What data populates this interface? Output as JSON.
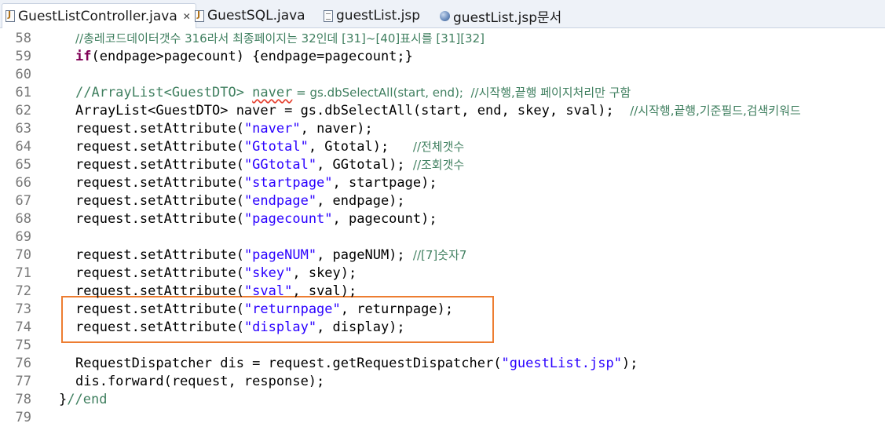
{
  "tabs": [
    {
      "label": "GuestListController.java",
      "icon": "java-file-icon",
      "close": "✕",
      "active": true
    },
    {
      "label": "GuestSQL.java",
      "icon": "java-file-icon",
      "active": false
    },
    {
      "label": "guestList.jsp",
      "icon": "jsp-file-icon",
      "active": false
    },
    {
      "label": "guestList.jsp문서",
      "icon": "globe-icon",
      "active": false
    }
  ],
  "editor": {
    "highlight_color": "#ed7d31",
    "highlighted_lines": [
      73,
      74
    ],
    "lines": [
      {
        "num": "58",
        "parts": [
          {
            "cls": "cm",
            "t": "//총레코드데이터갯수 316라서 최종페이지는 32인데 [31]~[40]표시를 [31][32]"
          }
        ]
      },
      {
        "num": "59",
        "parts": [
          {
            "cls": "kw",
            "t": "if"
          },
          {
            "cls": "",
            "t": "(endpage>pagecount) {endpage=pagecount;}"
          }
        ]
      },
      {
        "num": "60",
        "parts": []
      },
      {
        "num": "61",
        "parts": [
          {
            "cls": "cm",
            "t": "//ArrayList<GuestDTO> "
          },
          {
            "cls": "cm squiggle",
            "t": "naver"
          },
          {
            "cls": "cm",
            "t": " = gs.dbSelectAll(start, end);  //시작행,끝행 페이지처리만 구함"
          }
        ]
      },
      {
        "num": "62",
        "parts": [
          {
            "cls": "",
            "t": "ArrayList<GuestDTO> naver = gs.dbSelectAll(start, end, skey, sval);  "
          },
          {
            "cls": "cm",
            "t": "//시작행,끝행,기준필드,검색키워드"
          }
        ]
      },
      {
        "num": "63",
        "parts": [
          {
            "cls": "",
            "t": "request.setAttribute("
          },
          {
            "cls": "str",
            "t": "\"naver\""
          },
          {
            "cls": "",
            "t": ", naver);"
          }
        ]
      },
      {
        "num": "64",
        "parts": [
          {
            "cls": "",
            "t": "request.setAttribute("
          },
          {
            "cls": "str",
            "t": "\"Gtotal\""
          },
          {
            "cls": "",
            "t": ", Gtotal);   "
          },
          {
            "cls": "cm",
            "t": "//전체갯수"
          }
        ]
      },
      {
        "num": "65",
        "parts": [
          {
            "cls": "",
            "t": "request.setAttribute("
          },
          {
            "cls": "str",
            "t": "\"GGtotal\""
          },
          {
            "cls": "",
            "t": ", GGtotal); "
          },
          {
            "cls": "cm",
            "t": "//조회갯수"
          }
        ]
      },
      {
        "num": "66",
        "parts": [
          {
            "cls": "",
            "t": "request.setAttribute("
          },
          {
            "cls": "str",
            "t": "\"startpage\""
          },
          {
            "cls": "",
            "t": ", startpage);"
          }
        ]
      },
      {
        "num": "67",
        "parts": [
          {
            "cls": "",
            "t": "request.setAttribute("
          },
          {
            "cls": "str",
            "t": "\"endpage\""
          },
          {
            "cls": "",
            "t": ", endpage);"
          }
        ]
      },
      {
        "num": "68",
        "parts": [
          {
            "cls": "",
            "t": "request.setAttribute("
          },
          {
            "cls": "str",
            "t": "\"pagecount\""
          },
          {
            "cls": "",
            "t": ", pagecount);"
          }
        ]
      },
      {
        "num": "69",
        "parts": []
      },
      {
        "num": "70",
        "parts": [
          {
            "cls": "",
            "t": "request.setAttribute("
          },
          {
            "cls": "str",
            "t": "\"pageNUM\""
          },
          {
            "cls": "",
            "t": ", pageNUM); "
          },
          {
            "cls": "cm",
            "t": "//[7]숫자7"
          }
        ]
      },
      {
        "num": "71",
        "parts": [
          {
            "cls": "",
            "t": "request.setAttribute("
          },
          {
            "cls": "str",
            "t": "\"skey\""
          },
          {
            "cls": "",
            "t": ", skey);"
          }
        ]
      },
      {
        "num": "72",
        "parts": [
          {
            "cls": "",
            "t": "request.setAttribute("
          },
          {
            "cls": "str",
            "t": "\"sval\""
          },
          {
            "cls": "",
            "t": ", sval);"
          }
        ]
      },
      {
        "num": "73",
        "parts": [
          {
            "cls": "",
            "t": "request.setAttribute("
          },
          {
            "cls": "str",
            "t": "\"returnpage\""
          },
          {
            "cls": "",
            "t": ", returnpage);"
          }
        ]
      },
      {
        "num": "74",
        "parts": [
          {
            "cls": "",
            "t": "request.setAttribute("
          },
          {
            "cls": "str",
            "t": "\"display\""
          },
          {
            "cls": "",
            "t": ", display);"
          }
        ]
      },
      {
        "num": "75",
        "parts": []
      },
      {
        "num": "76",
        "parts": [
          {
            "cls": "",
            "t": "RequestDispatcher dis = request.getRequestDispatcher("
          },
          {
            "cls": "str",
            "t": "\"guestList.jsp\""
          },
          {
            "cls": "",
            "t": ");"
          }
        ]
      },
      {
        "num": "77",
        "parts": [
          {
            "cls": "",
            "t": "dis.forward(request, response);"
          }
        ]
      },
      {
        "num": "78",
        "parts": [
          {
            "cls": "",
            "t": "}"
          },
          {
            "cls": "cm",
            "t": "//end"
          }
        ]
      },
      {
        "num": "79",
        "parts": []
      }
    ]
  }
}
